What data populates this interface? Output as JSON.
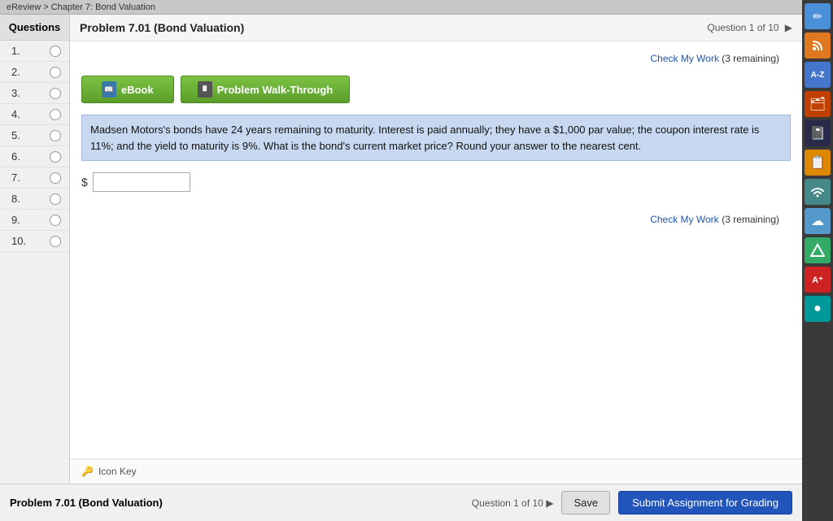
{
  "breadcrumb": {
    "text": "eReview > Chapter 7: Bond Valuation"
  },
  "header": {
    "questions_label": "Questions",
    "problem_title": "Problem 7.01 (Bond Valuation)",
    "question_counter": "Question 1 of 10",
    "arrow": "▶"
  },
  "questions": [
    {
      "number": "1.",
      "active": true
    },
    {
      "number": "2.",
      "active": false
    },
    {
      "number": "3.",
      "active": false
    },
    {
      "number": "4.",
      "active": false
    },
    {
      "number": "5.",
      "active": false
    },
    {
      "number": "6.",
      "active": false
    },
    {
      "number": "7.",
      "active": false
    },
    {
      "number": "8.",
      "active": false
    },
    {
      "number": "9.",
      "active": false
    },
    {
      "number": "10.",
      "active": false
    }
  ],
  "check_my_work": {
    "link_text": "Check My Work",
    "remaining": "(3 remaining)"
  },
  "buttons": {
    "ebook_label": "eBook",
    "walkthrough_label": "Problem Walk-Through"
  },
  "problem": {
    "text": "Madsen Motors's bonds have 24 years remaining to maturity. Interest is paid annually; they have a $1,000 par value; the coupon interest rate is 11%; and the yield to maturity is 9%. What is the bond's current market price? Round your answer to the nearest cent.",
    "dollar_sign": "$",
    "input_placeholder": ""
  },
  "icon_key": {
    "icon": "🔑",
    "label": "Icon Key"
  },
  "footer": {
    "problem_title": "Problem 7.01 (Bond Valuation)",
    "question_counter": "Question 1 of 10",
    "arrow": "▶",
    "save_label": "Save",
    "submit_label": "Submit Assignment for Grading"
  },
  "sidebar_icons": [
    {
      "name": "pencil-icon",
      "symbol": "✏",
      "color": "blue"
    },
    {
      "name": "rss-icon",
      "symbol": "📡",
      "color": "orange"
    },
    {
      "name": "az-icon",
      "symbol": "A-Z",
      "color": "blue"
    },
    {
      "name": "office-icon",
      "symbol": "🗂",
      "color": "orange"
    },
    {
      "name": "book-icon",
      "symbol": "📓",
      "color": "dark"
    },
    {
      "name": "sticky-icon",
      "symbol": "📋",
      "color": "orange"
    },
    {
      "name": "wifi-icon",
      "symbol": "📶",
      "color": "teal"
    },
    {
      "name": "cloud-icon",
      "symbol": "☁",
      "color": "cloud-blue"
    },
    {
      "name": "drive-icon",
      "symbol": "△",
      "color": "drive-green"
    },
    {
      "name": "a-red-icon",
      "symbol": "A+",
      "color": "red-a"
    },
    {
      "name": "circle-icon",
      "symbol": "●",
      "color": "teal"
    }
  ]
}
